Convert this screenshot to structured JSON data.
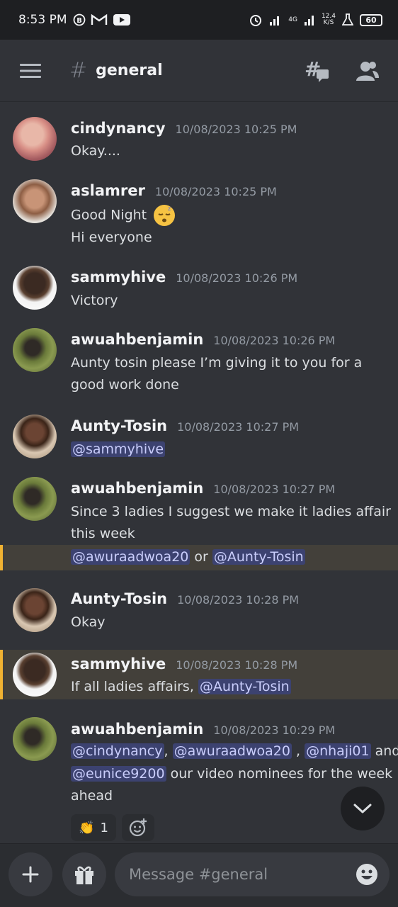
{
  "status_bar": {
    "time": "8:53 PM",
    "network": "4G",
    "speed_value": "12.4",
    "speed_unit": "K/S",
    "battery": "60"
  },
  "header": {
    "channel_name": "general"
  },
  "messages": [
    {
      "author": "cindynancy",
      "timestamp": "10/08/2023 10:25 PM",
      "lines": [
        "Okay...."
      ]
    },
    {
      "author": "aslamrer",
      "timestamp": "10/08/2023 10:25 PM",
      "lines": [
        "Good Night",
        "Hi everyone"
      ]
    },
    {
      "author": "sammyhive",
      "timestamp": "10/08/2023 10:26 PM",
      "lines": [
        "Victory"
      ]
    },
    {
      "author": "awuahbenjamin",
      "timestamp": "10/08/2023 10:26 PM",
      "lines": [
        "Aunty tosin please I’m giving it to you for a",
        "good work done"
      ]
    },
    {
      "author": "Aunty-Tosin",
      "timestamp": "10/08/2023 10:27 PM",
      "mention": "@sammyhive"
    },
    {
      "author": "awuahbenjamin",
      "timestamp": "10/08/2023 10:27 PM",
      "lines": [
        "Since 3 ladies I suggest we make it ladies affair",
        "this week"
      ],
      "followup": {
        "mention1": "@awuraadwoa20",
        "connector": " or ",
        "mention2": "@Aunty-Tosin"
      }
    },
    {
      "author": "Aunty-Tosin",
      "timestamp": "10/08/2023 10:28 PM",
      "lines": [
        "Okay"
      ]
    },
    {
      "author": "sammyhive",
      "timestamp": "10/08/2023 10:28 PM",
      "text": "If all ladies affairs, ",
      "mention": "@Aunty-Tosin"
    },
    {
      "author": "awuahbenjamin",
      "timestamp": "10/08/2023 10:29 PM",
      "mentions": [
        "@cindynancy",
        "@awuraadwoa20",
        "@nhaji01",
        "@eunice9200"
      ],
      "sep1": ", ",
      "sep2": " , ",
      "sep3": " and",
      "after": " our video nominees for the week",
      "last_line": "ahead"
    }
  ],
  "reaction": {
    "emoji": "👏",
    "count": "1"
  },
  "composer": {
    "placeholder": "Message #general"
  },
  "colors": {
    "background": "#313338",
    "mention_bg": "#3c4270",
    "highlight_border": "#f0b232"
  }
}
